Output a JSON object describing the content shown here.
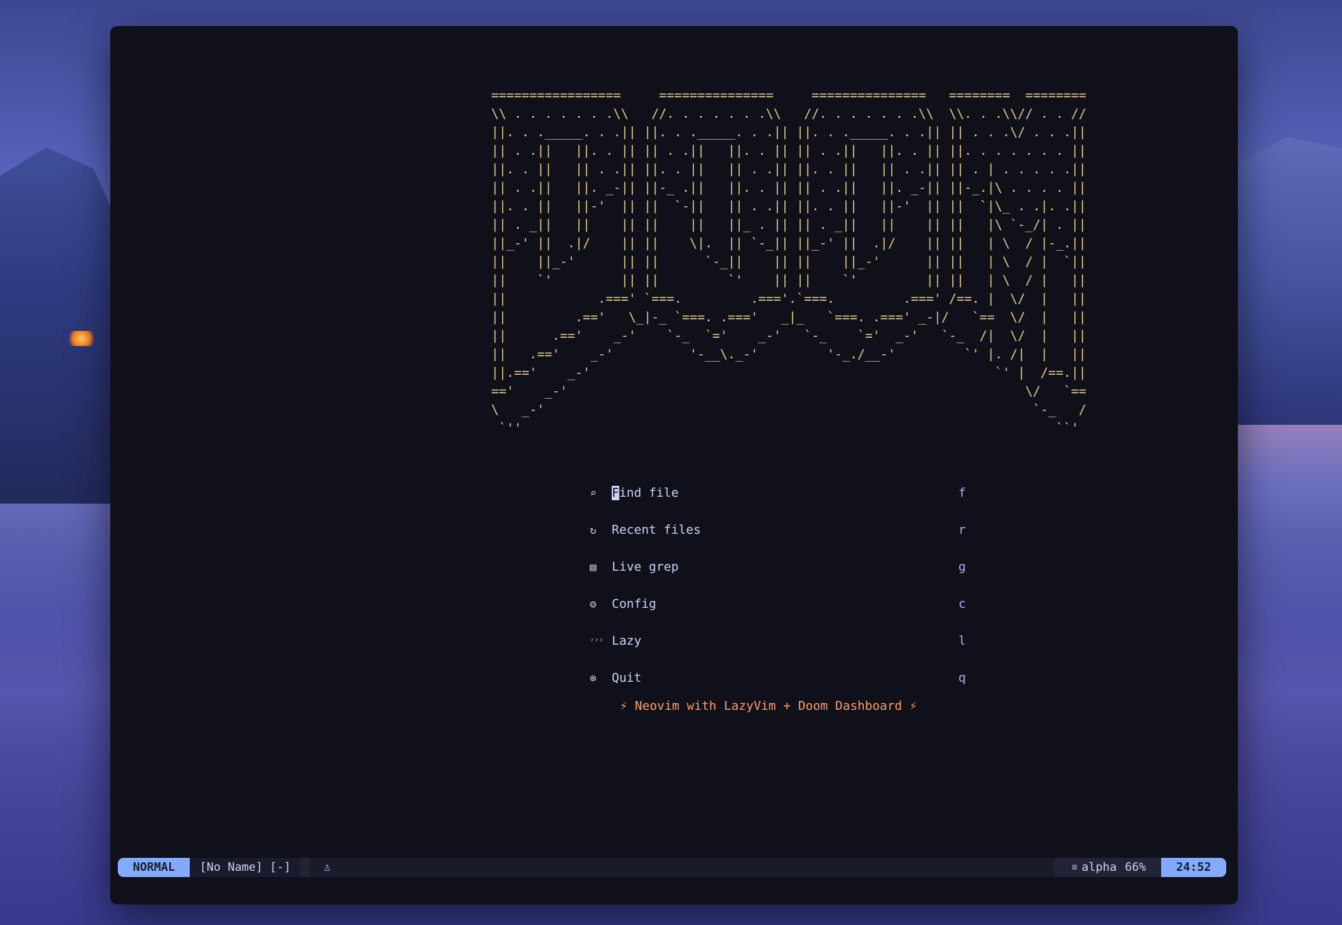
{
  "banner": {
    "ascii": "=================     ===============     ===============   ========  ========\n\\\\ . . . . . . .\\\\   //. . . . . . .\\\\   //. . . . . . .\\\\  \\\\. . .\\\\// . . //\n||. . ._____. . .|| ||. . ._____. . .|| ||. . ._____. . .|| || . . .\\/ . . .||\n|| . .||   ||. . || || . .||   ||. . || || . .||   ||. . || ||. . . . . . . ||\n||. . ||   || . .|| ||. . ||   || . .|| ||. . ||   || . .|| || . | . . . . .||\n|| . .||   ||. _-|| ||-_ .||   ||. . || || . .||   ||. _-|| ||-_.|\\ . . . . ||\n||. . ||   ||-'  || ||  `-||   || . .|| ||. . ||   ||-'  || ||  `|\\_ . .|. .||\n|| . _||   ||    || ||    ||   ||_ . || || . _||   ||    || ||   |\\ `-_/| . ||\n||_-' ||  .|/    || ||    \\|.  || `-_|| ||_-' ||  .|/    || ||   | \\  / |-_.||\n||    ||_-'      || ||      `-_||    || ||    ||_-'      || ||   | \\  / |  `||\n||    `'         || ||         `'    || ||    `'         || ||   | \\  / |   ||\n||            .===' `===.         .==='.`===.         .===' /==. |  \\/  |   ||\n||         .=='   \\_|-_ `===. .==='   _|_   `===. .===' _-|/   `==  \\/  |   ||\n||      .=='    _-'    `-_  `='    _-'   `-_    `='  _-'   `-_  /|  \\/  |   ||\n||   .=='    _-'          '-__\\._-'         '-_./__-'         `' |. /|  |   ||\n||.=='    _-'                                                     `' |  /==.||\n=='    _-'                                                            \\/   `==\n\\   _-'                                                                `-_   /\n `''                                                                      ``'"
  },
  "menu": {
    "items": [
      {
        "icon": "⌕",
        "label": "Find file",
        "key": "f"
      },
      {
        "icon": "↻",
        "label": "Recent files",
        "key": "r"
      },
      {
        "icon": "▤",
        "label": "Live grep",
        "key": "g"
      },
      {
        "icon": "⚙",
        "label": "Config",
        "key": "c"
      },
      {
        "icon": "ᶻᶻᶻ",
        "label": "Lazy",
        "key": "l"
      },
      {
        "icon": "⊗",
        "label": "Quit",
        "key": "q"
      }
    ],
    "first_char": "F",
    "first_rest": "ind file"
  },
  "footer": {
    "text": "⚡ Neovim with LazyVim + Doom Dashboard ⚡"
  },
  "statusline": {
    "mode": "NORMAL",
    "filename": "[No Name] [-]",
    "git_icon": "♙",
    "filetype_icon": "≡",
    "filetype": "alpha",
    "percent": "66%",
    "time": "24:52"
  },
  "colors": {
    "bg": "#0f1019",
    "banner": "#e7c987",
    "key": "#c6a0f6",
    "footer": "#ff9e64",
    "mode": "#82aaff"
  }
}
